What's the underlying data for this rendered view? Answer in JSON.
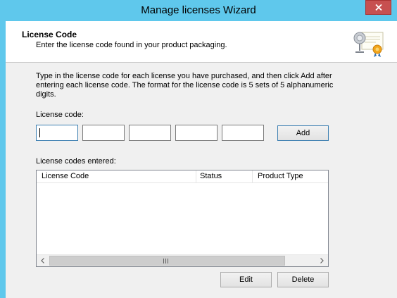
{
  "window": {
    "title": "Manage licenses Wizard",
    "close_label": "Close"
  },
  "header": {
    "title": "License Code",
    "subtitle": "Enter the license code found in your product packaging."
  },
  "body": {
    "instructions": "Type in the license code for each license you have purchased, and then click Add after entering each license code. The format for the license code is 5 sets of 5 alphanumeric digits.",
    "license_code_label": "License code:",
    "code_fields": [
      "",
      "",
      "",
      "",
      ""
    ],
    "add_label": "Add",
    "entered_label": "License codes entered:"
  },
  "list": {
    "columns": [
      "License Code",
      "Status",
      "Product Type"
    ],
    "rows": []
  },
  "buttons": {
    "edit_label": "Edit",
    "delete_label": "Delete"
  },
  "colors": {
    "titlebar": "#5fc8ec",
    "close": "#c75050",
    "focus_border": "#3c7fb1"
  },
  "icons": [
    "close-icon",
    "certificate-icon",
    "scroll-left-icon",
    "scroll-right-icon",
    "scroll-grip-icon"
  ]
}
